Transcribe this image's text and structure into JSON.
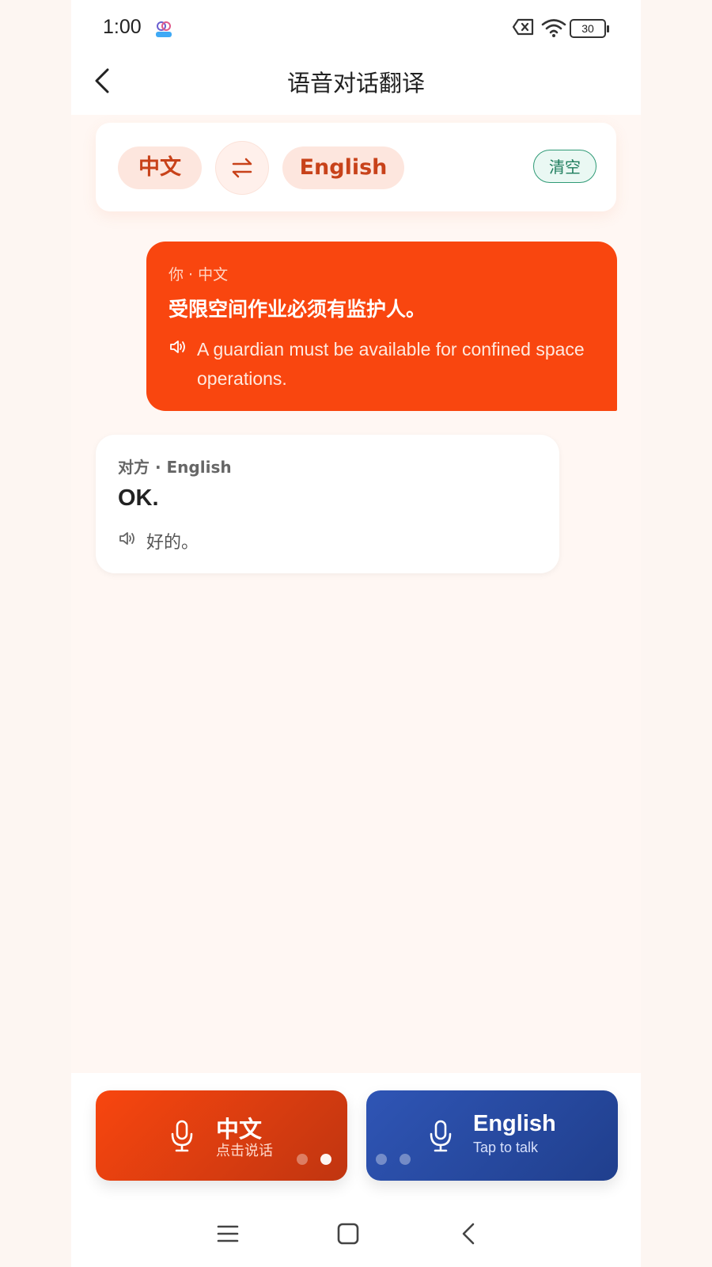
{
  "status_bar": {
    "time": "1:00",
    "battery_level": "30",
    "icons": [
      "app-notification-icon",
      "sim-no-signal-icon",
      "wifi-icon",
      "battery-icon"
    ]
  },
  "header": {
    "title": "语音对话翻译",
    "back_icon": "chevron-left-icon"
  },
  "language_bar": {
    "source_language": "中文",
    "target_language": "English",
    "swap_icon": "swap-arrows-icon",
    "clear_label": "清空"
  },
  "messages": [
    {
      "speaker_label": "你 · 中文",
      "source_text": "受限空间作业必须有监护人。",
      "translation": "A guardian must be available for confined space operations.",
      "icon": "speaker-icon"
    },
    {
      "speaker_label": "对方 · English",
      "source_text": "OK.",
      "translation": "好的。",
      "icon": "speaker-icon"
    }
  ],
  "talk_buttons": [
    {
      "title": "中文",
      "subtitle": "点击说话",
      "icon": "microphone-icon"
    },
    {
      "title": "English",
      "subtitle": "Tap to talk",
      "icon": "microphone-icon"
    }
  ],
  "navigation": [
    "menu-icon",
    "home-icon",
    "back-icon"
  ],
  "colors": {
    "accent_orange": "#f9460f",
    "accent_blue": "#2f55b5",
    "clear_green": "#2f9a76",
    "page_background": "#fff7f3"
  }
}
